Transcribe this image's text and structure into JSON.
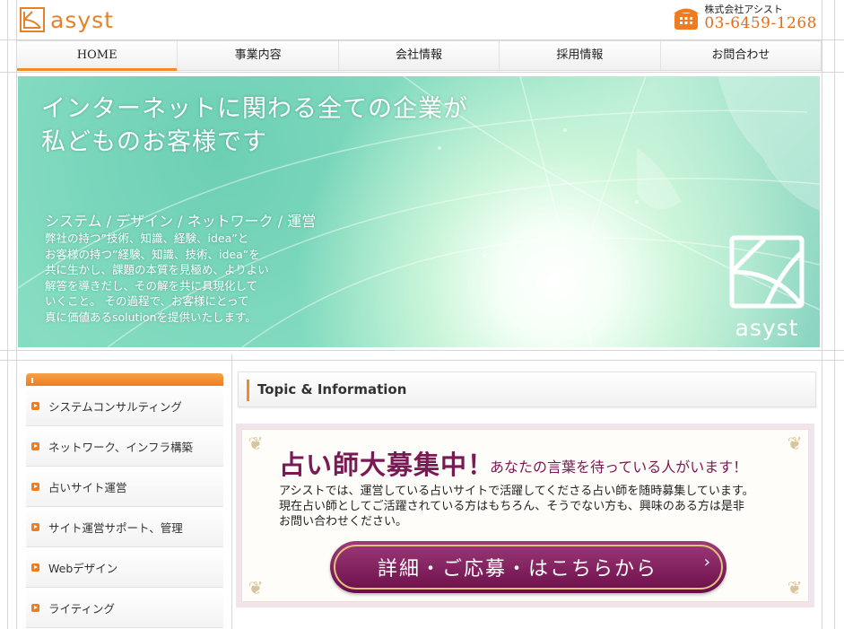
{
  "header": {
    "logo_text": "asyst",
    "company": "株式会社アシスト",
    "phone": "03-6459-1268"
  },
  "nav": {
    "items": [
      {
        "label": "HOME",
        "active": true
      },
      {
        "label": "事業内容"
      },
      {
        "label": "会社情報"
      },
      {
        "label": "採用情報"
      },
      {
        "label": "お問合わせ"
      }
    ]
  },
  "hero": {
    "headline_line1": "インターネットに関わる全ての企業が",
    "headline_line2": "私どものお客様です",
    "subheading": "システム / デザイン / ネットワーク / 運営",
    "body": "弊社の持つ”技術、知識、経験、idea”と\nお客様の持つ”経験、知識、技術、idea”を\n共に生かし、課題の本質を見極め、よりよい\n解答を導きだし、その解を共に具現化して\nいくこと。 その過程で、お客様にとって\n真に価値あるsolutionを提供いたします。",
    "logo_text": "asyst"
  },
  "sidebar": {
    "items": [
      {
        "label": "システムコンサルティング"
      },
      {
        "label": "ネットワーク、インフラ構築"
      },
      {
        "label": "占いサイト運営"
      },
      {
        "label": "サイト運営サポート、管理"
      },
      {
        "label": "Webデザイン"
      },
      {
        "label": "ライティング"
      }
    ]
  },
  "topic": {
    "title": "Topic & Information"
  },
  "recruit": {
    "title": "占い師大募集中！",
    "tagline": "あなたの言葉を待っている人がいます！",
    "body": "アシストでは、運営している占いサイトで活躍してくださる占い師を随時募集しています。\n現在占い師としてご活躍されている方はもちろん、そうでない方も、興味のある方は是非\nお問い合わせください。",
    "button_label": "詳細・ご応募・はこちらから"
  },
  "colors": {
    "accent": "#f08a2a",
    "recruit_purple": "#7a1a55",
    "hero_teal": "#6ccfb4"
  }
}
